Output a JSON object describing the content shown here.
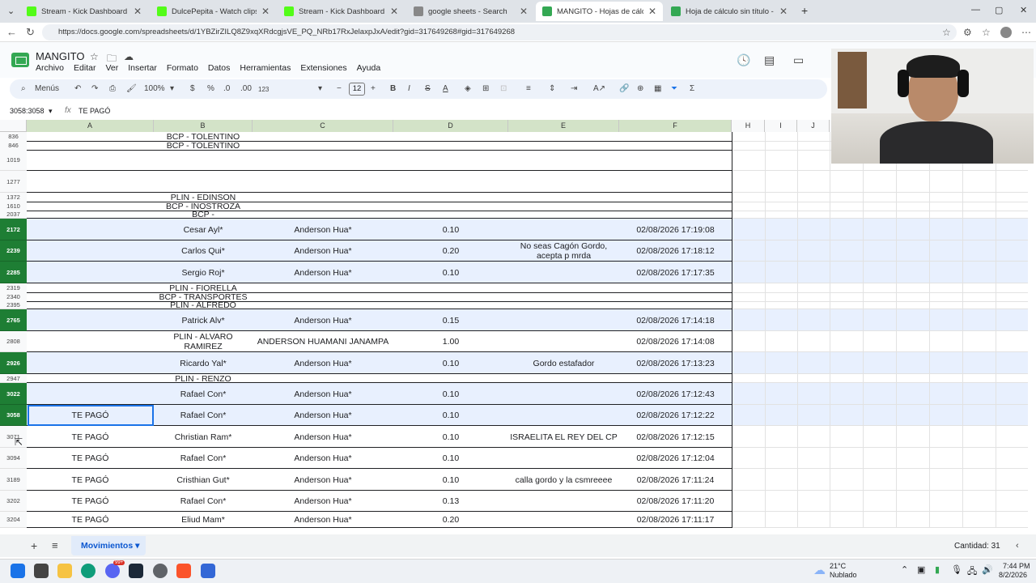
{
  "browser": {
    "tabs": [
      {
        "title": "Stream - Kick Dashboard",
        "color": "#53fc18"
      },
      {
        "title": "DulcePepita - Watch clips on Kick",
        "color": "#53fc18"
      },
      {
        "title": "Stream - Kick Dashboard",
        "color": "#53fc18"
      },
      {
        "title": "google sheets - Search",
        "color": "#888888"
      },
      {
        "title": "MANGITO - Hojas de cálculo de G",
        "color": "#34a853"
      },
      {
        "title": "Hoja de cálculo sin título - Hojas d",
        "color": "#34a853"
      }
    ],
    "url": "https://docs.google.com/spreadsheets/d/1YBZirZILQ8Z9xqXRdcgjsVE_PQ_NRb17RxJelaxpJxA/edit?gid=317649268#gid=317649268"
  },
  "doc": {
    "title": "MANGITO",
    "menu": [
      "Archivo",
      "Editar",
      "Ver",
      "Insertar",
      "Formato",
      "Datos",
      "Herramientas",
      "Extensiones",
      "Ayuda"
    ]
  },
  "toolbar": {
    "search": "Menús",
    "zoom": "100%",
    "currency": "$",
    "percent": "%",
    "dec_less": ".0",
    "dec_more": ".00",
    "format_123": "123",
    "font_size": "12"
  },
  "formula": {
    "namebox": "3058:3058",
    "value": "TE PAGÓ"
  },
  "columns": [
    "A",
    "B",
    "C",
    "D",
    "E",
    "F",
    "H",
    "I",
    "J"
  ],
  "rows": [
    {
      "num": "836",
      "a": "",
      "b": "BCP - TOLENTINO",
      "c": "",
      "d": "",
      "e": "",
      "f": ""
    },
    {
      "num": "846",
      "a": "",
      "b": "BCP - TOLENTINO",
      "c": "",
      "d": "",
      "e": "",
      "f": ""
    },
    {
      "num": "1019",
      "a": "",
      "b": "",
      "c": "",
      "d": "",
      "e": "",
      "f": ""
    },
    {
      "num": "1277",
      "a": "",
      "b": "",
      "c": "",
      "d": "",
      "e": "",
      "f": ""
    },
    {
      "num": "1372",
      "a": "",
      "b": "PLIN - EDINSON",
      "c": "",
      "d": "",
      "e": "",
      "f": ""
    },
    {
      "num": "1610",
      "a": "",
      "b": "BCP - INOSTROZA",
      "c": "",
      "d": "",
      "e": "",
      "f": ""
    },
    {
      "num": "2037",
      "a": "",
      "b": "BCP -",
      "c": "",
      "d": "",
      "e": "",
      "f": ""
    },
    {
      "num": "2172",
      "a": "",
      "b": "Cesar Ayl*",
      "c": "Anderson Hua*",
      "d": "0.10",
      "e": "",
      "f": "02/08/2026 17:19:08"
    },
    {
      "num": "2239",
      "a": "",
      "b": "Carlos Qui*",
      "c": "Anderson Hua*",
      "d": "0.20",
      "e": "No seas Cagón Gordo, acepta p mrda",
      "f": "02/08/2026 17:18:12"
    },
    {
      "num": "2285",
      "a": "",
      "b": "Sergio Roj*",
      "c": "Anderson Hua*",
      "d": "0.10",
      "e": "",
      "f": "02/08/2026 17:17:35"
    },
    {
      "num": "2319",
      "a": "",
      "b": "PLIN - FIORELLA",
      "c": "",
      "d": "",
      "e": "",
      "f": ""
    },
    {
      "num": "2340",
      "a": "",
      "b": "BCP - TRANSPORTES",
      "c": "",
      "d": "",
      "e": "",
      "f": ""
    },
    {
      "num": "2395",
      "a": "",
      "b": "PLIN - ALFREDO",
      "c": "",
      "d": "",
      "e": "",
      "f": ""
    },
    {
      "num": "2765",
      "a": "",
      "b": "Patrick Alv*",
      "c": "Anderson Hua*",
      "d": "0.15",
      "e": "",
      "f": "02/08/2026 17:14:18"
    },
    {
      "num": "2808",
      "a": "",
      "b": "PLIN - ALVARO RAMIREZ",
      "c": "ANDERSON HUAMANI JANAMPA",
      "d": "1.00",
      "e": "",
      "f": "02/08/2026 17:14:08"
    },
    {
      "num": "2926",
      "a": "",
      "b": "Ricardo Yal*",
      "c": "Anderson Hua*",
      "d": "0.10",
      "e": "Gordo estafador",
      "f": "02/08/2026 17:13:23"
    },
    {
      "num": "2947",
      "a": "",
      "b": "PLIN - RENZO",
      "c": "",
      "d": "",
      "e": "",
      "f": ""
    },
    {
      "num": "3022",
      "a": "",
      "b": "Rafael Con*",
      "c": "Anderson Hua*",
      "d": "0.10",
      "e": "",
      "f": "02/08/2026 17:12:43"
    },
    {
      "num": "3058",
      "a": "TE PAGÓ",
      "b": "Rafael Con*",
      "c": "Anderson Hua*",
      "d": "0.10",
      "e": "",
      "f": "02/08/2026 17:12:22"
    },
    {
      "num": "3071",
      "a": "TE PAGÓ",
      "b": "Christian Ram*",
      "c": "Anderson Hua*",
      "d": "0.10",
      "e": "ISRAELITA EL REY DEL CP",
      "f": "02/08/2026 17:12:15"
    },
    {
      "num": "3094",
      "a": "TE PAGÓ",
      "b": "Rafael Con*",
      "c": "Anderson Hua*",
      "d": "0.10",
      "e": "",
      "f": "02/08/2026 17:12:04"
    },
    {
      "num": "3189",
      "a": "TE PAGÓ",
      "b": "Cristhian Gut*",
      "c": "Anderson Hua*",
      "d": "0.10",
      "e": "calla gordo y la csmreeee",
      "f": "02/08/2026 17:11:24"
    },
    {
      "num": "3202",
      "a": "TE PAGÓ",
      "b": "Rafael Con*",
      "c": "Anderson Hua*",
      "d": "0.13",
      "e": "",
      "f": "02/08/2026 17:11:20"
    },
    {
      "num": "3204",
      "a": "TE PAGÓ",
      "b": "Eliud Mam*",
      "c": "Anderson Hua*",
      "d": "0.20",
      "e": "",
      "f": "02/08/2026 17:11:17"
    }
  ],
  "sheet": {
    "tab_name": "Movimientos",
    "count": "Cantidad: 31"
  },
  "system": {
    "temp": "21°C",
    "weather": "Nublado",
    "time": "7:44 PM",
    "date": "8/2/2026",
    "badge": "99+"
  }
}
